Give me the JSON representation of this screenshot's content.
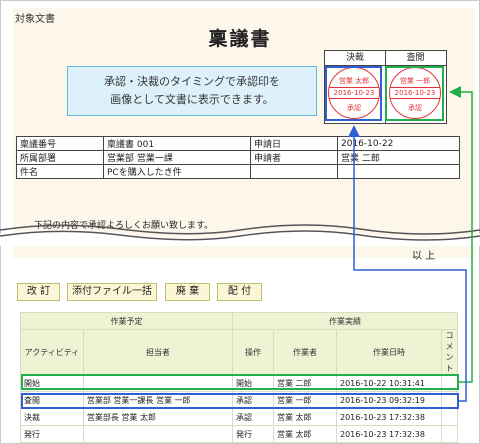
{
  "document": {
    "label": "対象文書",
    "title": "稟議書",
    "stamp_headers": [
      "決裁",
      "査閲"
    ],
    "stamps": [
      {
        "name": "営業 太郎",
        "date": "2016-10-23",
        "word": "承認"
      },
      {
        "name": "営業 一郎",
        "date": "2016-10-23",
        "word": "承認"
      }
    ],
    "callout": {
      "line1": "承認・決裁のタイミングで承認印を",
      "line2": "画像として文書に表示できます。"
    },
    "info_rows": [
      [
        "稟議番号",
        "稟議書 001",
        "申請日",
        "2016-10-22"
      ],
      [
        "所属部署",
        "営業部 営業一課",
        "申請者",
        "営業 二郎"
      ],
      [
        "件名",
        "PCを購入したき件",
        "",
        ""
      ]
    ],
    "request_text": "下記の内容で承認よろしくお願い致します。",
    "end_text": "以 上"
  },
  "buttons": [
    "改 訂",
    "添付ファイル一括",
    "廃 棄",
    "配 付"
  ],
  "tasks": {
    "group_headers": [
      "作業予定",
      "作業実績"
    ],
    "columns": [
      "アクティビティ",
      "担当者",
      "操作",
      "作業者",
      "作業日時",
      "コメント"
    ],
    "rows": [
      [
        "開始",
        "",
        "開始",
        "営業 二郎",
        "2016-10-22 10:31:41",
        ""
      ],
      [
        "査閲",
        "営業部 営業一課長 営業 一郎",
        "承認",
        "営業 一郎",
        "2016-10-23 09:32:19",
        ""
      ],
      [
        "決裁",
        "営業部長 営業 太郎",
        "承認",
        "営業 太郎",
        "2016-10-23 17:32:38",
        ""
      ],
      [
        "発行",
        "",
        "発行",
        "営業 太郎",
        "2016-10-23 17:32:38",
        ""
      ]
    ]
  },
  "colors": {
    "highlight_blue": "#2f5fd0",
    "highlight_green": "#21b04b",
    "stamp_red": "#e2333a",
    "callout_bg": "#dcf1fa"
  }
}
